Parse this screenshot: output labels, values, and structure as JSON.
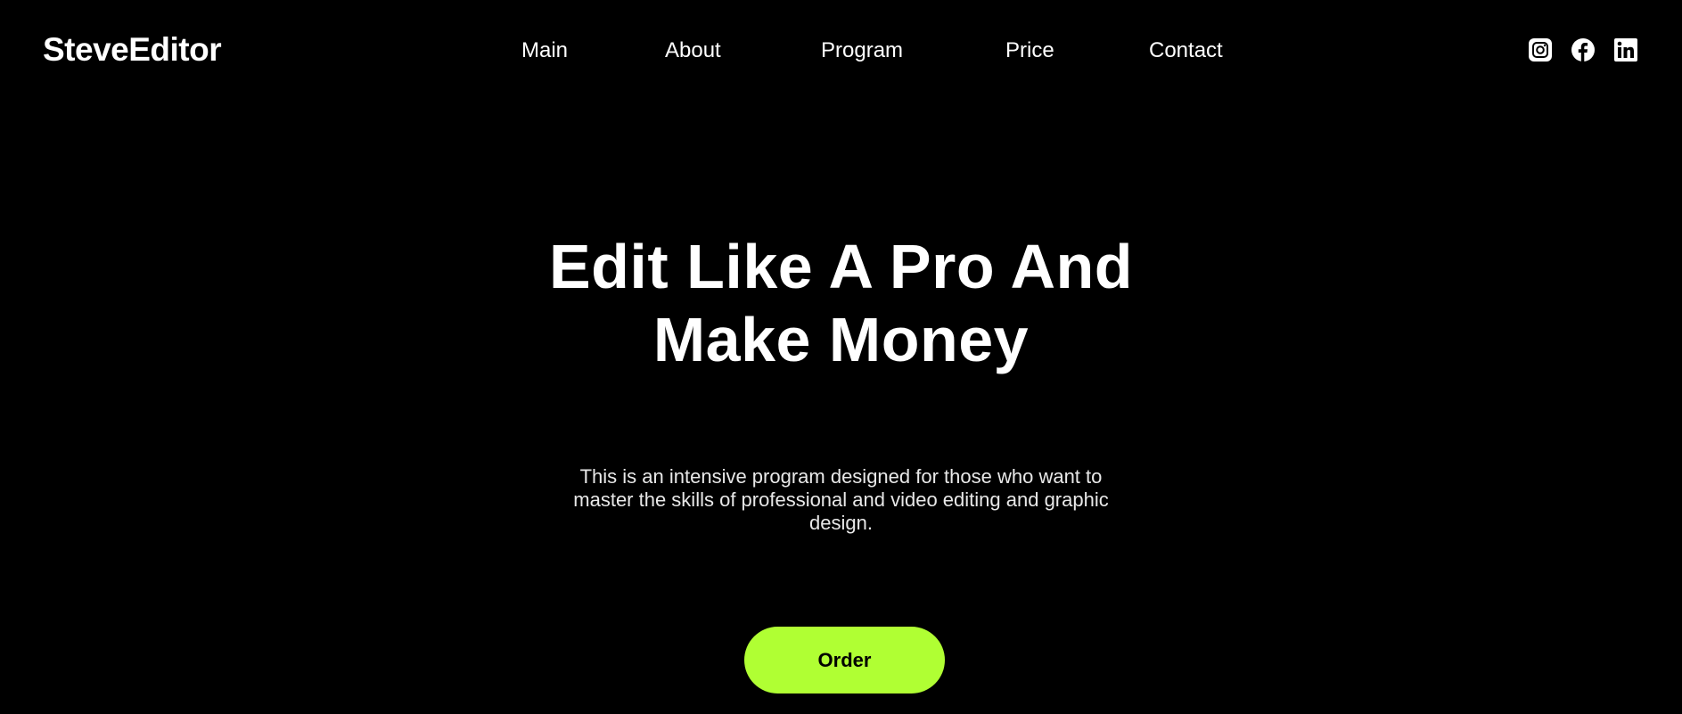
{
  "header": {
    "logo": "SteveEditor",
    "nav": [
      {
        "label": "Main"
      },
      {
        "label": "About"
      },
      {
        "label": "Program"
      },
      {
        "label": "Price"
      },
      {
        "label": "Contact"
      }
    ],
    "socials": [
      {
        "icon": "instagram-icon"
      },
      {
        "icon": "facebook-icon"
      },
      {
        "icon": "linkedin-icon"
      }
    ]
  },
  "hero": {
    "title_line1": "Edit Like A Pro And",
    "title_line2": "Make Money",
    "text_line1": "This is an intensive program designed for those who want to",
    "text_line2": "master the skills of professional and video editing and graphic",
    "text_line3": "design.",
    "button_label": "Order"
  },
  "colors": {
    "background": "#000000",
    "text": "#ffffff",
    "accent": "#b0ff33"
  }
}
